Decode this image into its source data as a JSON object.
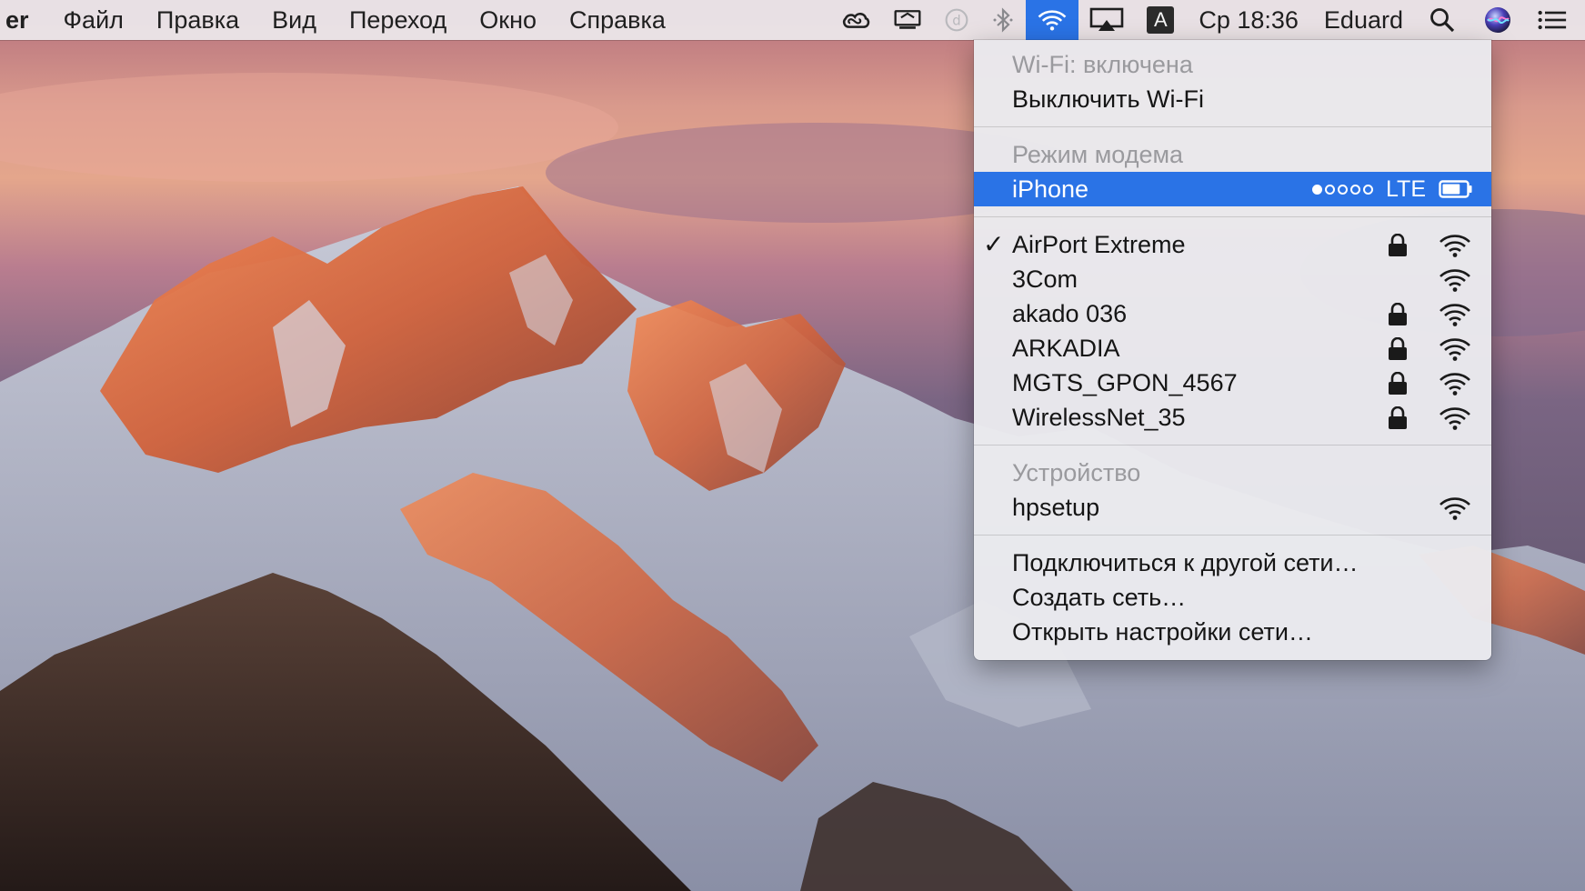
{
  "menubar": {
    "app_name": "er",
    "menus": [
      "Файл",
      "Правка",
      "Вид",
      "Переход",
      "Окно",
      "Справка"
    ],
    "status_icons": [
      "creative-cloud-icon",
      "screen-mirror-icon",
      "dropbox-icon",
      "bluetooth-icon",
      "wifi-icon",
      "airplay-icon",
      "input-source-icon"
    ],
    "input_source_label": "A",
    "clock": "Ср 18:36",
    "user": "Eduard"
  },
  "wifi_menu": {
    "status_header": "Wi-Fi: включена",
    "toggle_label": "Выключить Wi-Fi",
    "hotspot_header": "Режим модема",
    "hotspot": {
      "name": "iPhone",
      "signal_bars": 1,
      "signal_max": 5,
      "network_type": "LTE",
      "battery_level": 0.75
    },
    "networks": [
      {
        "name": "AirPort Extreme",
        "connected": true,
        "locked": true
      },
      {
        "name": "3Com",
        "connected": false,
        "locked": false
      },
      {
        "name": "akado 036",
        "connected": false,
        "locked": true
      },
      {
        "name": "ARKADIA",
        "connected": false,
        "locked": true
      },
      {
        "name": "MGTS_GPON_4567",
        "connected": false,
        "locked": true
      },
      {
        "name": "WirelessNet_35",
        "connected": false,
        "locked": true
      }
    ],
    "devices_header": "Устройство",
    "devices": [
      {
        "name": "hpsetup",
        "locked": false
      }
    ],
    "actions": [
      "Подключиться к другой сети…",
      "Создать сеть…",
      "Открыть настройки сети…"
    ]
  },
  "colors": {
    "accent": "#2a73e6",
    "menubar_bg": "#ece8ec",
    "menu_bg": "#eaeaee",
    "header_text": "#9a9a9e"
  }
}
